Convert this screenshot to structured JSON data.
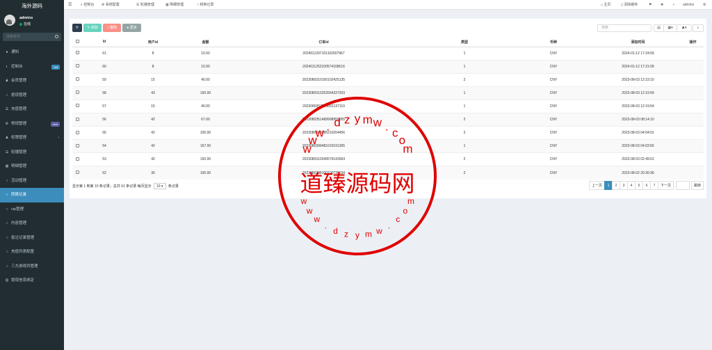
{
  "sidebar": {
    "logo": "海外源码",
    "username": "admins",
    "status": "在线",
    "search_placeholder": "搜索菜单",
    "items": [
      {
        "label": "通知",
        "icon": "circle-icon",
        "glyph": "●"
      },
      {
        "label": "控制台",
        "icon": "dashboard-icon",
        "glyph": "◐",
        "badge": "hot"
      },
      {
        "label": "会员管理",
        "icon": "users-icon",
        "glyph": "♟"
      },
      {
        "label": "提现管理",
        "icon": "circle-outline-icon",
        "glyph": "○"
      },
      {
        "label": "充值管理",
        "icon": "list-icon",
        "glyph": "☰"
      },
      {
        "label": "常规管理",
        "icon": "gear-icon",
        "glyph": "⚙",
        "badge": "new"
      },
      {
        "label": "权限管理",
        "icon": "group-icon",
        "glyph": "♟",
        "arrow": "‹"
      },
      {
        "label": "轮播管理",
        "icon": "list-icon",
        "glyph": "☰"
      },
      {
        "label": "明细管理",
        "icon": "calendar-icon",
        "glyph": "▦"
      },
      {
        "label": "活动管理",
        "icon": "circle-outline-icon",
        "glyph": "○"
      },
      {
        "label": "转换记录",
        "icon": "circle-outline-icon",
        "glyph": "○",
        "active": true
      },
      {
        "label": "vip管理",
        "icon": "circle-outline-icon",
        "glyph": "○"
      },
      {
        "label": "内容管理",
        "icon": "circle-outline-icon",
        "glyph": "○"
      },
      {
        "label": "投注记录管理",
        "icon": "circle-outline-icon",
        "glyph": "○"
      },
      {
        "label": "充值列表配置",
        "icon": "circle-outline-icon",
        "glyph": "○"
      },
      {
        "label": "三方游戏列管理",
        "icon": "circle-outline-icon",
        "glyph": "○"
      },
      {
        "label": "提现信息绑定",
        "icon": "bank-icon",
        "glyph": "▥"
      }
    ]
  },
  "topbar": {
    "tabs": [
      {
        "label": "控制台",
        "icon": "dashboard-icon",
        "glyph": "◐"
      },
      {
        "label": "系统配置",
        "icon": "gear-icon",
        "glyph": "⚙"
      },
      {
        "label": "轮播管理",
        "icon": "list-icon",
        "glyph": "☰"
      },
      {
        "label": "明细管理",
        "icon": "calendar-icon",
        "glyph": "▦"
      },
      {
        "label": "转换记录",
        "icon": "circle-outline-icon",
        "glyph": "○"
      }
    ],
    "home": "主页",
    "clear_cache": "清除缓存",
    "admin": "admins"
  },
  "toolbar": {
    "add": "添加",
    "delete": "删除",
    "more": "更多",
    "search_placeholder": "搜索"
  },
  "table": {
    "columns": [
      "Id",
      "用户id",
      "金额",
      "订单id",
      "类型",
      "币种",
      "添加时间",
      "操作"
    ],
    "rows": [
      [
        "61",
        "8",
        "10.00",
        "20240112971011025079​67",
        "1",
        "CNY",
        "2024-01-12 17:24:59"
      ],
      [
        "60",
        "8",
        "10.00",
        "20240112521005741685​16",
        "1",
        "CNY",
        "2024-01-12 17:21:09"
      ],
      [
        "59",
        "15",
        "40.00",
        "20230803101501024251​35",
        "2",
        "CNY",
        "2023-08-03 12:23:10"
      ],
      [
        "58",
        "43",
        "150.00",
        "20230803102525643372​03",
        "1",
        "CNY",
        "2023-08-03 12:19:59"
      ],
      [
        "57",
        "15",
        "40.00",
        "20230803575056531371​19",
        "1",
        "CNY",
        "2023-08-03 12:19:54"
      ],
      [
        "56",
        "42",
        "67.00",
        "20230803514899989590​55",
        "2",
        "CNY",
        "2023-08-03 08:14:10"
      ],
      [
        "55",
        "42",
        "100.00",
        "20230803499852102044​56",
        "2",
        "CNY",
        "2023-08-03 04:04:01"
      ],
      [
        "54",
        "42",
        "167.00",
        "20230803994810191913​65",
        "1",
        "CNY",
        "2023-08-03 04:03:56"
      ],
      [
        "53",
        "42",
        "150.00",
        "20230803100495791435​64",
        "2",
        "CNY",
        "2023-08-03 02:49:01"
      ],
      [
        "52",
        "30",
        "100.00",
        "20230802981001007356​34",
        "2",
        "CNY",
        "2023-08-02 20:30:36"
      ]
    ]
  },
  "footer": {
    "info_prefix": "显示第 1 到第 10 条记录，总共 61 条记录 每页显示",
    "page_size": "10",
    "info_suffix": "条记录"
  },
  "pager": {
    "prev": "上一页",
    "pages": [
      "1",
      "2",
      "3",
      "4",
      "5",
      "6",
      "7"
    ],
    "next": "下一页",
    "jump": "跳转"
  },
  "watermark": {
    "text": "道臻源码网",
    "url": "www.dzymw.com"
  },
  "colors": {
    "sidebar_bg": "#222d32",
    "accent": "#3c8dbc",
    "btn_add": "#18bc9c",
    "btn_delete": "#f75444",
    "btn_more": "#95a5a6",
    "btn_refresh": "#2c3e50",
    "watermark_red": "#e00000"
  }
}
